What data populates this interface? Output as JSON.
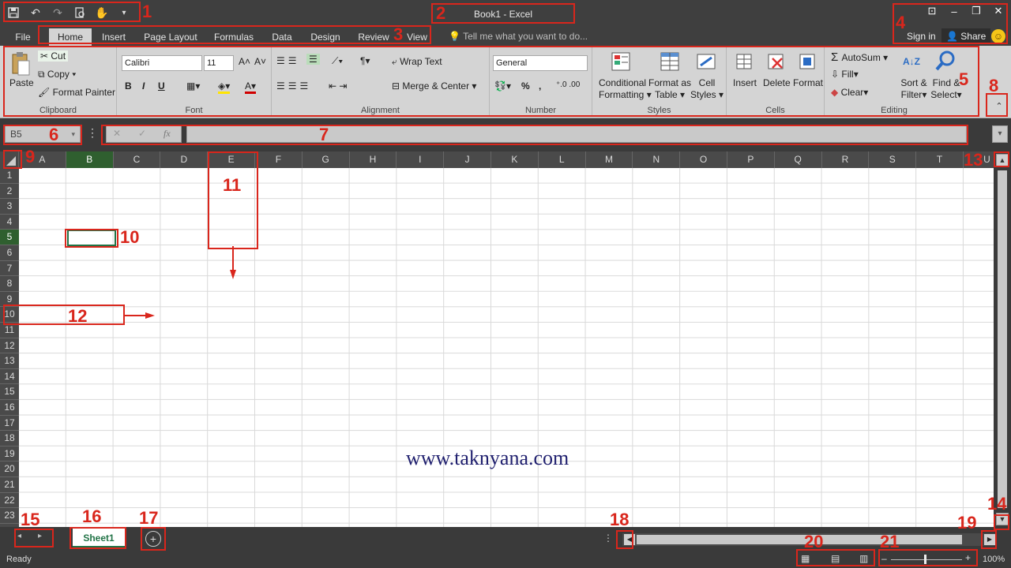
{
  "window": {
    "title": "Book1 - Excel"
  },
  "tabs": {
    "file": "File",
    "home": "Home",
    "insert": "Insert",
    "page_layout": "Page Layout",
    "formulas": "Formulas",
    "data": "Data",
    "design": "Design",
    "review": "Review",
    "view": "View"
  },
  "tell_me": {
    "placeholder": "Tell me what you want to do..."
  },
  "account": {
    "sign_in": "Sign in",
    "share": "Share"
  },
  "ribbon": {
    "clipboard": {
      "label": "Clipboard",
      "paste": "Paste",
      "cut": "Cut",
      "copy": "Copy",
      "format_painter": "Format Painter"
    },
    "font": {
      "label": "Font",
      "name": "Calibri",
      "size": "11",
      "bold": "B",
      "italic": "I",
      "underline": "U"
    },
    "alignment": {
      "label": "Alignment",
      "wrap": "Wrap Text",
      "merge": "Merge & Center"
    },
    "number": {
      "label": "Number",
      "format": "General",
      "percent": "%",
      "comma": ","
    },
    "styles": {
      "label": "Styles",
      "cond1": "Conditional",
      "cond2": "Formatting",
      "fmt1": "Format as",
      "fmt2": "Table",
      "cell1": "Cell",
      "cell2": "Styles"
    },
    "cells": {
      "label": "Cells",
      "insert": "Insert",
      "delete": "Delete",
      "format": "Format"
    },
    "editing": {
      "label": "Editing",
      "autosum": "AutoSum",
      "fill": "Fill",
      "clear": "Clear",
      "sort1": "Sort &",
      "sort2": "Filter",
      "find1": "Find &",
      "find2": "Select"
    }
  },
  "formula_bar": {
    "name_box": "B5",
    "fx": "fx"
  },
  "grid": {
    "columns": [
      "A",
      "B",
      "C",
      "D",
      "E",
      "F",
      "G",
      "H",
      "I",
      "J",
      "K",
      "L",
      "M",
      "N",
      "O",
      "P",
      "Q",
      "R",
      "S",
      "T",
      "U"
    ],
    "rows": [
      "1",
      "2",
      "3",
      "4",
      "5",
      "6",
      "7",
      "8",
      "9",
      "10",
      "11",
      "12",
      "13",
      "14",
      "15",
      "16",
      "17",
      "18",
      "19",
      "20",
      "21",
      "22",
      "23"
    ],
    "selected_column": "B",
    "selected_row": "5"
  },
  "sheets": {
    "active": "Sheet1"
  },
  "status": {
    "ready": "Ready",
    "zoom": "100%"
  },
  "watermark": "www.taknyana.com",
  "annotations": [
    "1",
    "2",
    "3",
    "4",
    "5",
    "6",
    "7",
    "8",
    "9",
    "10",
    "11",
    "12",
    "13",
    "14",
    "15",
    "16",
    "17",
    "18",
    "19",
    "20",
    "21"
  ],
  "colors": {
    "accent": "#217346",
    "annotation": "#d9261c"
  }
}
